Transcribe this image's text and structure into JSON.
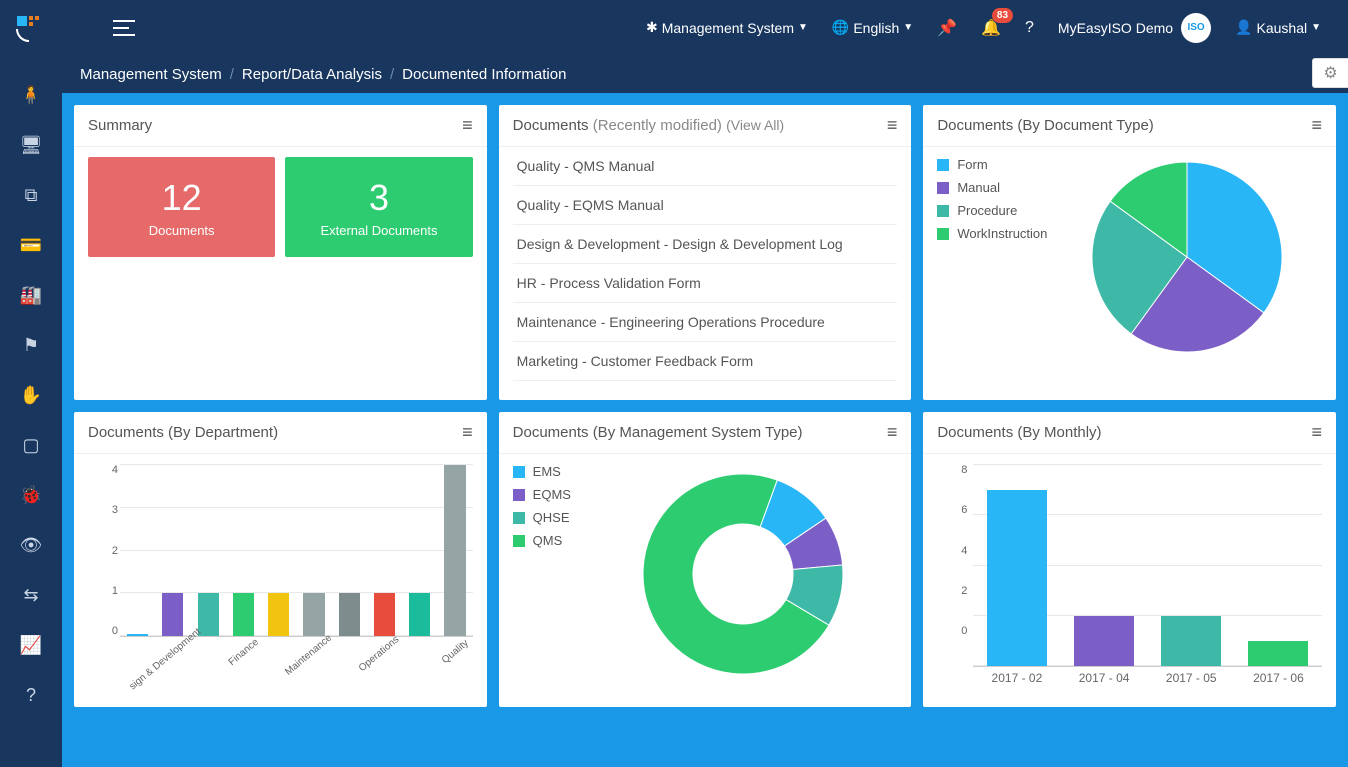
{
  "topbar": {
    "management_label": "Management System",
    "language_label": "English",
    "notifications_count": "83",
    "company_label": "MyEasyISO Demo",
    "user_label": "Kaushal"
  },
  "breadcrumb": {
    "part1": "Management System",
    "part2": "Report/Data Analysis",
    "part3": "Documented Information"
  },
  "cards": {
    "summary": {
      "title": "Summary",
      "tiles": [
        {
          "value": "12",
          "label": "Documents",
          "color": "#e66a6a"
        },
        {
          "value": "3",
          "label": "External Documents",
          "color": "#2ecc71"
        }
      ]
    },
    "recent": {
      "title_prefix": "Documents ",
      "title_muted": "(Recently modified) ",
      "view_all": "(View All)",
      "items": [
        "Quality - QMS Manual",
        "Quality - EQMS Manual",
        "Design & Development - Design & Development Log",
        "HR - Process Validation Form",
        "Maintenance - Engineering Operations Procedure",
        "Marketing - Customer Feedback Form"
      ]
    },
    "by_type": {
      "title": "Documents (By Document Type)",
      "legend": [
        {
          "label": "Form",
          "color": "#29b6f6"
        },
        {
          "label": "Manual",
          "color": "#7b5fc6"
        },
        {
          "label": "Procedure",
          "color": "#3eb9a7"
        },
        {
          "label": "WorkInstruction",
          "color": "#2ecc71"
        }
      ]
    },
    "by_dept": {
      "title": "Documents (By Department)"
    },
    "by_mgmt": {
      "title": "Documents (By Management System Type)",
      "legend": [
        {
          "label": "EMS",
          "color": "#29b6f6"
        },
        {
          "label": "EQMS",
          "color": "#7b5fc6"
        },
        {
          "label": "QHSE",
          "color": "#3eb9a7"
        },
        {
          "label": "QMS",
          "color": "#2ecc71"
        }
      ]
    },
    "by_month": {
      "title": "Documents (By Monthly)"
    }
  },
  "chart_data": [
    {
      "id": "by_type_pie",
      "type": "pie",
      "title": "Documents (By Document Type)",
      "series": [
        {
          "name": "Form",
          "value": 35,
          "color": "#29b6f6"
        },
        {
          "name": "Manual",
          "value": 25,
          "color": "#7b5fc6"
        },
        {
          "name": "Procedure",
          "value": 25,
          "color": "#3eb9a7"
        },
        {
          "name": "WorkInstruction",
          "value": 15,
          "color": "#2ecc71"
        }
      ]
    },
    {
      "id": "by_dept_bar",
      "type": "bar",
      "title": "Documents (By Department)",
      "ylim": [
        0,
        4
      ],
      "categories": [
        "sign & Development",
        "",
        "Finance",
        "",
        "Maintenance",
        "",
        "Operations",
        "",
        "",
        "Quality"
      ],
      "colors_cycle": [
        "#29b6f6",
        "#7b5fc6",
        "#3eb9a7",
        "#2ecc71",
        "#f1c40f",
        "#95a5a6",
        "#7f8c8d",
        "#e74c3c",
        "#1abc9c",
        "#95a5a6"
      ],
      "values": [
        0,
        1,
        1,
        1,
        1,
        1,
        1,
        1,
        1,
        4
      ]
    },
    {
      "id": "by_mgmt_donut",
      "type": "pie",
      "title": "Documents (By Management System Type)",
      "series": [
        {
          "name": "EMS",
          "value": 10,
          "color": "#29b6f6"
        },
        {
          "name": "EQMS",
          "value": 8,
          "color": "#7b5fc6"
        },
        {
          "name": "QHSE",
          "value": 10,
          "color": "#3eb9a7"
        },
        {
          "name": "QMS",
          "value": 72,
          "color": "#2ecc71"
        }
      ]
    },
    {
      "id": "by_month_bar",
      "type": "bar",
      "title": "Documents (By Monthly)",
      "ylim": [
        0,
        8
      ],
      "categories": [
        "2017 - 02",
        "2017 - 04",
        "2017 - 05",
        "2017 - 06"
      ],
      "colors": [
        "#29b6f6",
        "#7b5fc6",
        "#3eb9a7",
        "#2ecc71"
      ],
      "values": [
        7,
        2,
        2,
        1
      ]
    }
  ]
}
